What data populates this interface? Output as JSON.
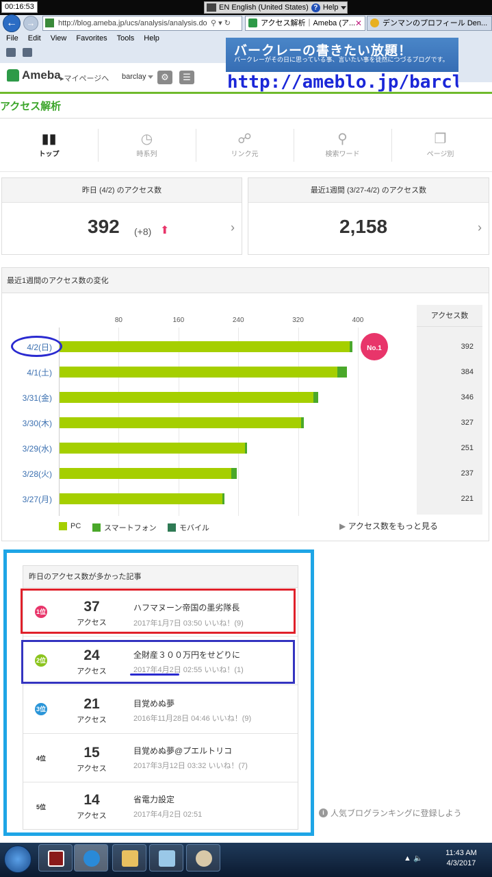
{
  "system": {
    "clock": "00:16:53",
    "language": "EN English (United States)",
    "help": "Help"
  },
  "browser": {
    "address": "http://blog.ameba.jp/ucs/analysis/analysis.do",
    "tabs": [
      {
        "label": "アクセス解析｜Ameba (ア..."
      },
      {
        "label": "デンマンのプロフィール Den..."
      }
    ],
    "menu": [
      "File",
      "Edit",
      "View",
      "Favorites",
      "Tools",
      "Help"
    ]
  },
  "banner": {
    "title": "バークレーの書きたい放題！",
    "subtitle": "バークレーがその日に思っている事、言いたい事を徒然につづるブログです。",
    "url": "http://ameblo.jp/barclay"
  },
  "header": {
    "logo": "Ameba",
    "mypage": "▸マイページへ",
    "user": "barclay"
  },
  "page_title": "アクセス解析",
  "nav_tabs": [
    {
      "label": "トップ",
      "icon": "bar-chart-icon",
      "active": true
    },
    {
      "label": "時系列",
      "icon": "clock-icon",
      "active": false
    },
    {
      "label": "リンク元",
      "icon": "link-icon",
      "active": false
    },
    {
      "label": "検索ワード",
      "icon": "search-icon",
      "active": false
    },
    {
      "label": "ページ別",
      "icon": "pages-icon",
      "active": false
    }
  ],
  "stats": {
    "yesterday": {
      "label": "昨日 (4/2) のアクセス数",
      "value": "392",
      "delta": "(+8)"
    },
    "week": {
      "label": "最近1週間 (3/27-4/2) のアクセス数",
      "value": "2,158"
    }
  },
  "chart_section": {
    "title": "最近1週間のアクセス数の変化",
    "access_column_header": "アクセス数",
    "badge": "No.1",
    "more_link": "アクセス数をもっと見る",
    "legend": [
      "PC",
      "スマートフォン",
      "モバイル"
    ]
  },
  "chart_data": {
    "type": "bar",
    "orientation": "horizontal",
    "stacked": true,
    "categories": [
      "4/2(日)",
      "4/1(土)",
      "3/31(金)",
      "3/30(木)",
      "3/29(水)",
      "3/28(火)",
      "3/27(月)"
    ],
    "ticks": [
      80,
      160,
      240,
      320,
      400
    ],
    "xlim": [
      0,
      400
    ],
    "series": [
      {
        "name": "PC",
        "values": [
          388,
          372,
          340,
          323,
          248,
          230,
          218
        ],
        "color": "#a5cf00"
      },
      {
        "name": "スマートフォン",
        "values": [
          4,
          12,
          6,
          4,
          3,
          7,
          3
        ],
        "color": "#4aa82a"
      },
      {
        "name": "モバイル",
        "values": [
          0,
          0,
          0,
          0,
          0,
          0,
          0
        ],
        "color": "#2e7a54"
      }
    ],
    "totals": [
      "392",
      "384",
      "346",
      "327",
      "251",
      "237",
      "221"
    ]
  },
  "articles": {
    "title": "昨日のアクセス数が多かった記事",
    "access_label": "アクセス",
    "items": [
      {
        "rank": "1位",
        "count": "37",
        "title": "ハフマヌーン帝国の墨劣隊長",
        "meta": "2017年1月7日 03:50 いいね！(9)",
        "badge_color": "#e8356a"
      },
      {
        "rank": "2位",
        "count": "24",
        "title": "全財産３００万円をせどりに",
        "meta": "2017年4月2日 02:55 いいね！(1)",
        "badge_color": "#8cc41e"
      },
      {
        "rank": "3位",
        "count": "21",
        "title": "目覚めぬ夢",
        "meta": "2016年11月28日 04:46 いいね！(9)",
        "badge_color": "#2a95d8"
      },
      {
        "rank": "4位",
        "count": "15",
        "title": "目覚めぬ夢@プエルトリコ",
        "meta": "2017年3月12日 03:32 いいね！(7)",
        "badge_color": ""
      },
      {
        "rank": "5位",
        "count": "14",
        "title": "省電力設定",
        "meta": "2017年4月2日 02:51",
        "badge_color": ""
      }
    ],
    "ranking_link": "人気ブログランキングに登録しよう"
  },
  "taskbar": {
    "time": "11:43 AM",
    "date": "4/3/2017"
  }
}
